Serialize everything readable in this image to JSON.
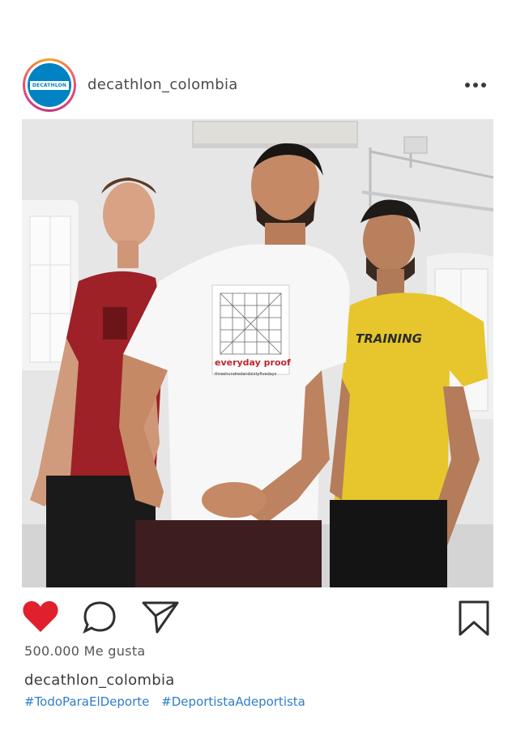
{
  "post": {
    "username": "decathlon_colombia",
    "avatar_text": "DECATHLON",
    "more_icon": "more-horizontal-icon",
    "photo": {
      "shirt_red_text": "",
      "shirt_white_text": "everyday proof",
      "shirt_white_sub": "threehundredandsixtyfivedays",
      "shirt_yellow_text": "TRAINING"
    },
    "likes": "500.000 Me gusta",
    "caption_user": "decathlon_colombia",
    "hashtags": [
      "#TodoParaElDeporte",
      "#DeportistaAdeportista"
    ]
  },
  "colors": {
    "heart": "#e0202c",
    "hashtag": "#2f7dc9",
    "brand": "#0082c3"
  }
}
